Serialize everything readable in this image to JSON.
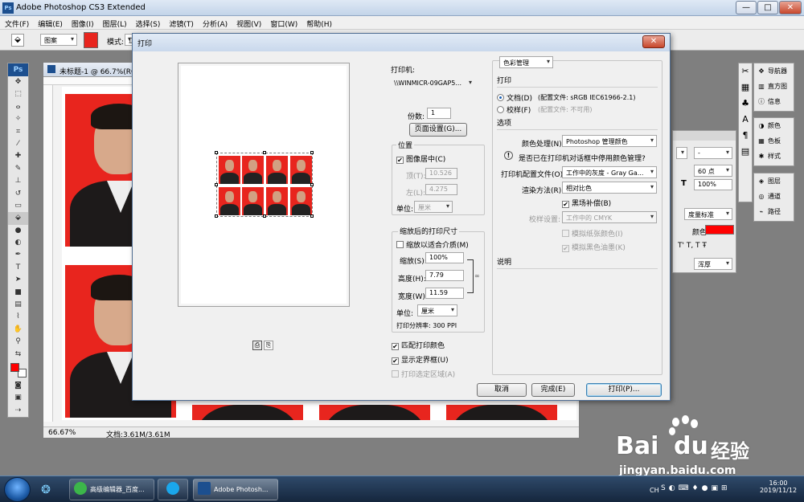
{
  "app": {
    "title": "Adobe Photoshop CS3 Extended",
    "logo": "Ps",
    "win_buttons": [
      "—",
      "□",
      "✕"
    ]
  },
  "menu": [
    "文件(F)",
    "编辑(E)",
    "图像(I)",
    "图层(L)",
    "选择(S)",
    "滤镜(T)",
    "分析(A)",
    "视图(V)",
    "窗口(W)",
    "帮助(H)"
  ],
  "options_bar": {
    "preset": "图案",
    "mode_label": "模式:",
    "mode_value": "正"
  },
  "document": {
    "title": "未标题-1 @ 66.7%(RGB",
    "zoom": "66.67%",
    "doc_info": "文档:3.61M/3.61M"
  },
  "print_dialog": {
    "title": "打印",
    "close": "✕",
    "printer_label": "打印机:",
    "printer_value": "\\\\WINMICR-09GAP5...",
    "copies_label": "份数:",
    "copies_value": "1",
    "page_setup_button": "页面设置(G)...",
    "position": {
      "legend": "位置",
      "center_label": "图像居中(C)",
      "center_checked": true,
      "top_label": "顶(T):",
      "top_value": "10.526",
      "left_label": "左(L):",
      "left_value": "4.275",
      "unit_label": "单位:",
      "unit_value": "厘米"
    },
    "scaled": {
      "legend": "缩放后的打印尺寸",
      "fit_label": "缩放以适合介质(M)",
      "fit_checked": false,
      "scale_label": "缩放(S):",
      "scale_value": "100%",
      "height_label": "高度(H):",
      "height_value": "7.79",
      "width_label": "宽度(W):",
      "width_value": "11.59",
      "unit_label": "单位:",
      "unit_value": "厘米",
      "resolution": "打印分辨率: 300 PPI"
    },
    "match_colors_label": "匹配打印颜色",
    "match_colors_checked": true,
    "show_bbox_label": "显示定界框(U)",
    "show_bbox_checked": true,
    "print_selected_label": "打印选定区域(A)",
    "print_selected_checked": false,
    "color_management_dropdown": "色彩管理",
    "print_section": "打印",
    "document_radio": "文档(D)",
    "document_profile": "(配置文件: sRGB IEC61966-2.1)",
    "proof_radio": "校样(F)",
    "proof_profile": "(配置文件: 不可用)",
    "options_section": "选项",
    "color_handling_label": "颜色处理(N):",
    "color_handling_value": "Photoshop 管理颜色",
    "warning_icon": "!",
    "warning_text": "是否已在打印机对话框中停用颜色管理?",
    "printer_profile_label": "打印机配置文件(O):",
    "printer_profile_value": "工作中的灰度 - Gray Ga...",
    "rendering_intent_label": "渲染方法(R):",
    "rendering_intent_value": "相对比色",
    "bpc_label": "黑场补偿(B)",
    "bpc_checked": true,
    "proof_setup_label": "校样设置:",
    "proof_setup_value": "工作中的 CMYK",
    "sim_paper_label": "模拟纸张颜色(I)",
    "sim_black_label": "模拟黑色油墨(K)",
    "description_label": "说明",
    "cancel_button": "取消",
    "done_button": "完成(E)",
    "print_button": "打印(P)..."
  },
  "panels": {
    "group1": [
      "导航器",
      "直方图",
      "信息"
    ],
    "group2": [
      "颜色",
      "色板",
      "样式"
    ],
    "group3": [
      "图层",
      "通道",
      "路径"
    ],
    "char_panel": {
      "size_value": "60 点",
      "scale_value": "100%",
      "aa_value": "浑厚",
      "color_label": "颜色:",
      "measure_value": "度量标准",
      "dash_value": "-"
    }
  },
  "taskbar": {
    "items": [
      "高级编辑器_百度...",
      "",
      "Adobe Photosh..."
    ],
    "time": "16:00",
    "date": "2019/11/12",
    "lang": "CH"
  },
  "watermark": {
    "logo_text": "Bai",
    "logo_text2": "du",
    "cn_text": "经验",
    "url": "jingyan.baidu.com"
  },
  "colors": {
    "photo_background": "#e8251e",
    "foreground_swatch": "#ff0000",
    "accent": "#1a5fb4"
  }
}
